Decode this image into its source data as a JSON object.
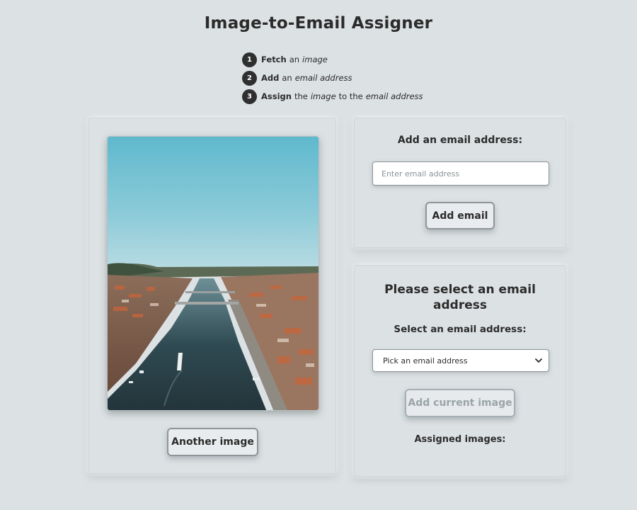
{
  "title": "Image-to-Email Assigner",
  "steps": [
    {
      "num": "1",
      "verb": "Fetch",
      "text1": "an",
      "text2": "image",
      "text3": "",
      "text4": ""
    },
    {
      "num": "2",
      "verb": "Add",
      "text1": "an",
      "text2": "email address",
      "text3": "",
      "text4": ""
    },
    {
      "num": "3",
      "verb": "Assign",
      "text1": "the",
      "text2": "image",
      "text3": "to the",
      "text4": "email address"
    }
  ],
  "image_panel": {
    "another_label": "Another image"
  },
  "email_panel": {
    "heading": "Add an email address:",
    "input_value": "",
    "input_placeholder": "Enter email address",
    "add_label": "Add email"
  },
  "assign_panel": {
    "heading": "Please select an email address",
    "select_label": "Select an email address:",
    "select_value": "Pick an email address",
    "assign_label": "Add current image",
    "assigned_label": "Assigned images:"
  },
  "colors": {
    "background": "#dce1e3",
    "text": "#2b2b2b",
    "disabled_text": "#9aa4a8"
  },
  "icons": {
    "select_arrow": "chevron-down-icon"
  }
}
